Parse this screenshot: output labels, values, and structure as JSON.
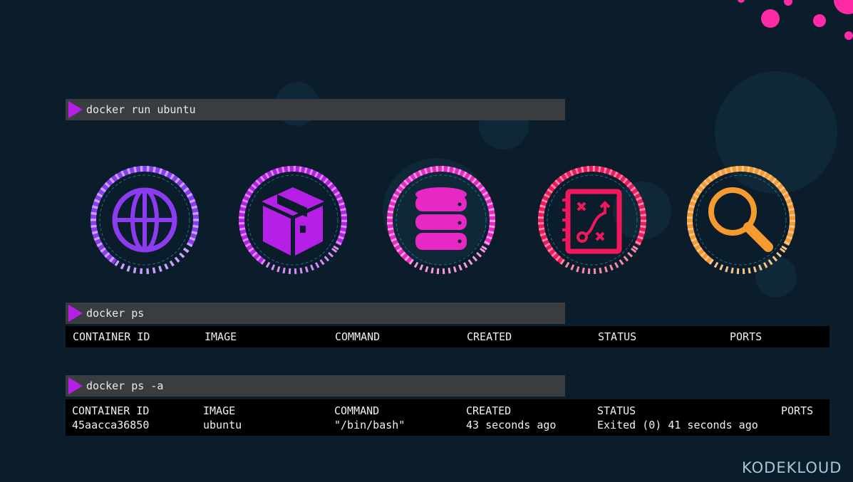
{
  "commands": {
    "run": "docker run ubuntu",
    "ps": "docker ps",
    "ps_all": "docker ps -a"
  },
  "ps_output": {
    "headers": [
      "CONTAINER ID",
      "IMAGE",
      "COMMAND",
      "CREATED",
      "STATUS",
      "PORTS"
    ]
  },
  "ps_all_output": {
    "headers": [
      "CONTAINER ID",
      "IMAGE",
      "COMMAND",
      "CREATED",
      "STATUS",
      "PORTS"
    ],
    "rows": [
      [
        "45aacca36850",
        "ubuntu",
        "\"/bin/bash\"",
        "43 seconds ago",
        "Exited (0) 41 seconds ago",
        ""
      ]
    ]
  },
  "icons": [
    {
      "name": "globe-icon",
      "color": "#8b3cf0"
    },
    {
      "name": "package-box-icon",
      "color": "#b620e6"
    },
    {
      "name": "database-icon",
      "color": "#e827c4"
    },
    {
      "name": "strategy-board-icon",
      "color": "#f2175c"
    },
    {
      "name": "magnifier-icon",
      "color": "#f59a2f"
    }
  ],
  "logo": {
    "text": "KODEKLOUD"
  },
  "colors": {
    "background": "#0b1d2a",
    "command_bar": "#3a3d40",
    "prompt_arrow": "#b620e6",
    "accent_pink": "#ff3aa8"
  }
}
